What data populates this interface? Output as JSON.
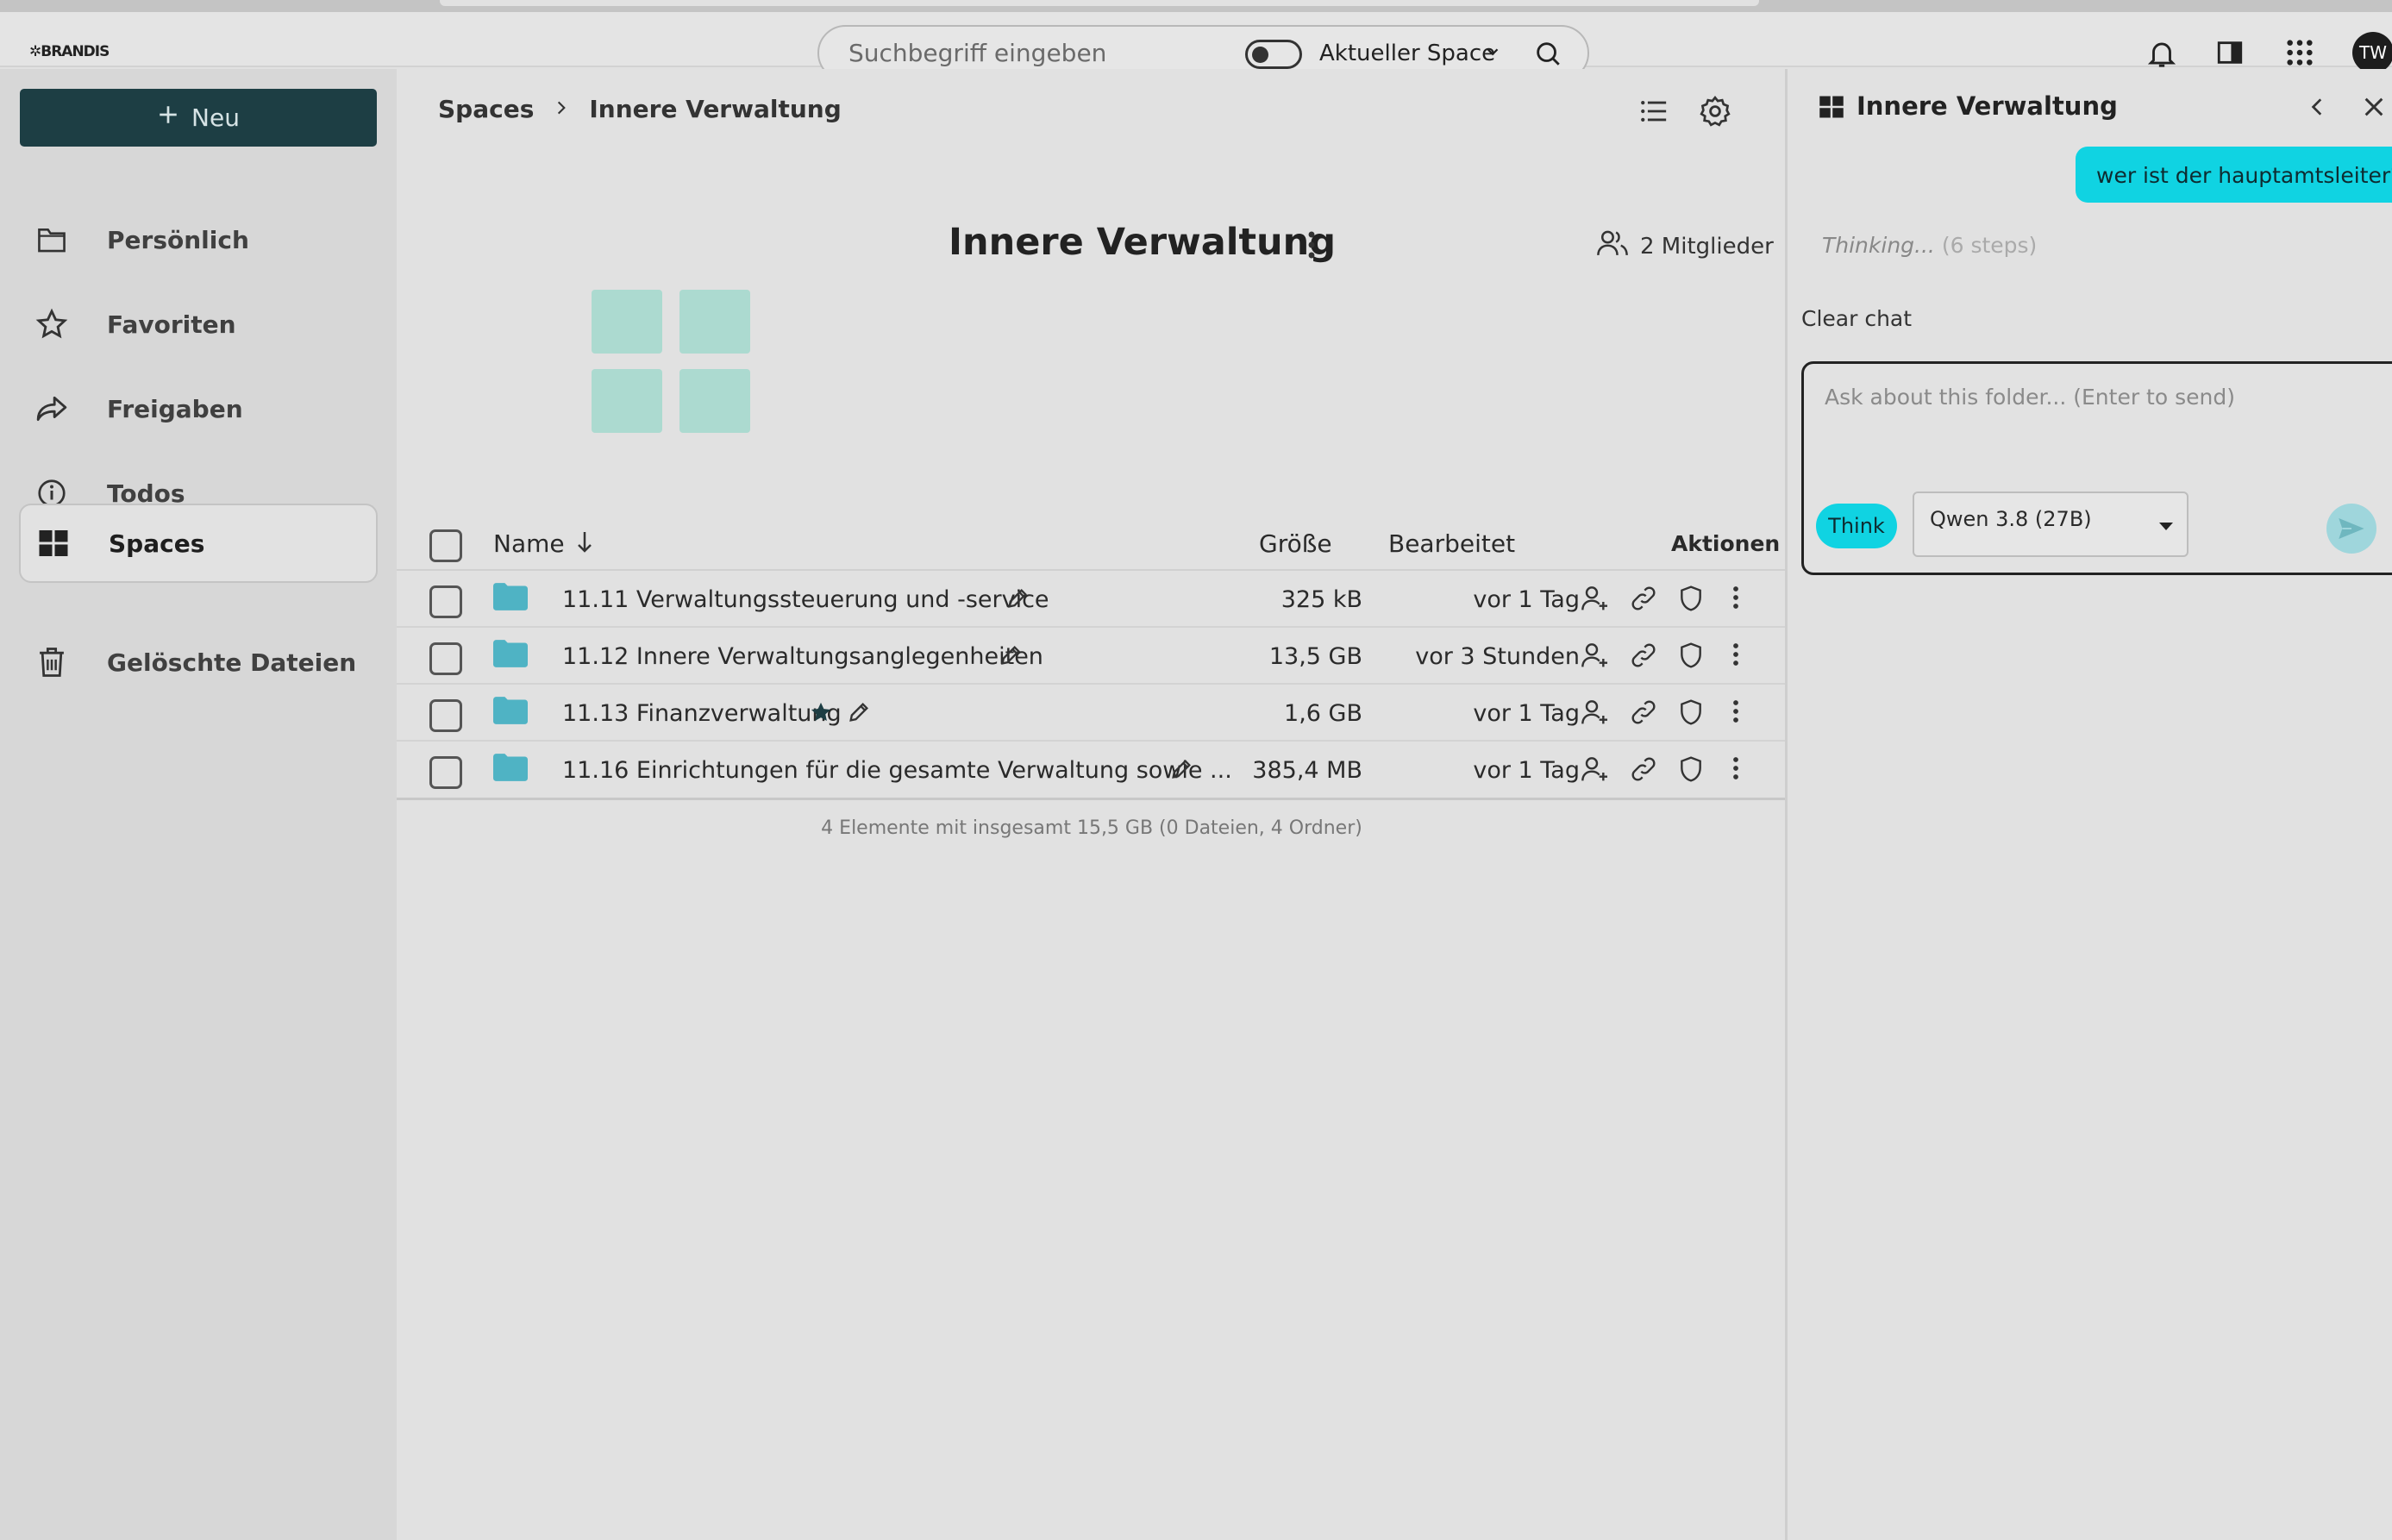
{
  "topbar": {
    "logo_text": "BRANDIS",
    "search_placeholder": "Suchbegriff eingeben",
    "scope_label": "Aktueller Space",
    "avatar_initials": "TW"
  },
  "sidebar": {
    "new_button": "Neu",
    "items": [
      {
        "label": "Persönlich",
        "icon": "folder-icon"
      },
      {
        "label": "Favoriten",
        "icon": "star-icon"
      },
      {
        "label": "Freigaben",
        "icon": "share-icon"
      },
      {
        "label": "Todos",
        "icon": "info-icon"
      },
      {
        "label": "Spaces",
        "icon": "grid-icon",
        "active": true
      },
      {
        "label": "Gelöschte Dateien",
        "icon": "trash-icon"
      }
    ]
  },
  "main": {
    "breadcrumb": [
      "Spaces",
      "Innere Verwaltung"
    ],
    "space_title": "Innere Verwaltung",
    "members_label": "2 Mitglieder",
    "columns": {
      "name": "Name",
      "size": "Größe",
      "modified": "Bearbeitet",
      "actions": "Aktionen"
    },
    "rows": [
      {
        "name": "11.11 Verwaltungssteuerung und -service",
        "size": "325 kB",
        "modified": "vor 1 Tag",
        "starred": false
      },
      {
        "name": "11.12 Innere Verwaltungsanglegenheiten",
        "size": "13,5 GB",
        "modified": "vor 3 Stunden",
        "starred": false
      },
      {
        "name": "11.13 Finanzverwaltung",
        "size": "1,6 GB",
        "modified": "vor 1 Tag",
        "starred": true
      },
      {
        "name": "11.16 Einrichtungen für die gesamte Verwaltung sowie ...",
        "size": "385,4 MB",
        "modified": "vor 1 Tag",
        "starred": false
      }
    ],
    "summary": "4 Elemente mit insgesamt 15,5 GB (0 Dateien, 4 Ordner)",
    "colors": {
      "folder": "#4fb3c4",
      "tile": "#acdad0",
      "new_button": "#1d3e44"
    }
  },
  "chat": {
    "title": "Innere Verwaltung",
    "user_message": "wer ist der hauptamtsleiter?",
    "thinking_label": "Thinking...",
    "thinking_steps": "(6 steps)",
    "clear_label": "Clear chat",
    "input_placeholder": "Ask about this folder... (Enter to send)",
    "think_button": "Think",
    "model": "Qwen 3.8 (27B)",
    "colors": {
      "accent": "#10d3e2"
    }
  }
}
